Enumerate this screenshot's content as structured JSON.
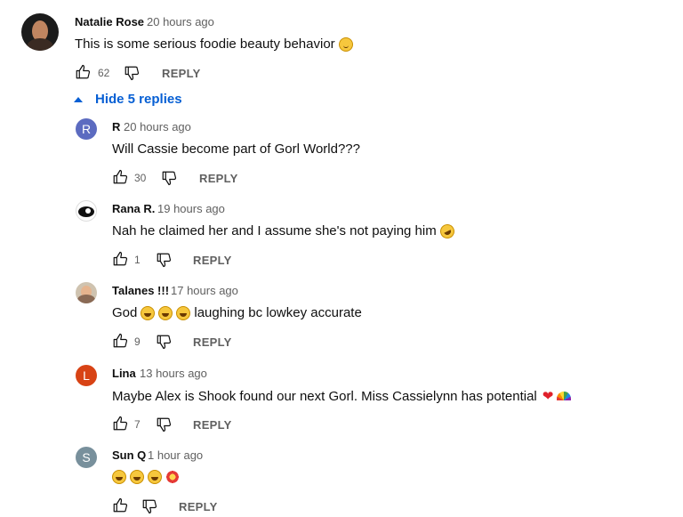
{
  "top_comment": {
    "author": "Natalie Rose",
    "time": "20 hours ago",
    "text": "This is some serious foodie beauty behavior",
    "emoji": "slightly-smiling-face",
    "likes": "62",
    "reply_label": "REPLY"
  },
  "hide_replies_label": "Hide 5 replies",
  "replies": [
    {
      "author": "R",
      "avatar_letter": "R",
      "avatar_color": "#5c6bc0",
      "time": "20 hours ago",
      "text": "Will Cassie become part of Gorl World???",
      "likes": "30",
      "reply_label": "REPLY"
    },
    {
      "author": "Rana R.",
      "time": "19 hours ago",
      "text": "Nah he claimed her and I assume she's not paying him",
      "emoji": "rolling-on-floor-laughing",
      "likes": "1",
      "reply_label": "REPLY"
    },
    {
      "author": "Talanes !!!",
      "time": "17 hours ago",
      "text_before": "God",
      "text_after": "laughing bc lowkey accurate",
      "emoji": "face-with-tears-of-joy",
      "likes": "9",
      "reply_label": "REPLY"
    },
    {
      "author": "Lina",
      "avatar_letter": "L",
      "avatar_color": "#d84315",
      "time": "13 hours ago",
      "text": "Maybe Alex is Shook found our next Gorl. Miss Cassielynn has potential",
      "emoji": "red-heart rainbow",
      "likes": "7",
      "reply_label": "REPLY"
    },
    {
      "author": "Sun Q",
      "avatar_letter": "S",
      "avatar_color": "#78909c",
      "time": "1 hour ago",
      "emoji": "face-with-tears-of-joy x3 collision",
      "reply_label": "REPLY"
    }
  ]
}
